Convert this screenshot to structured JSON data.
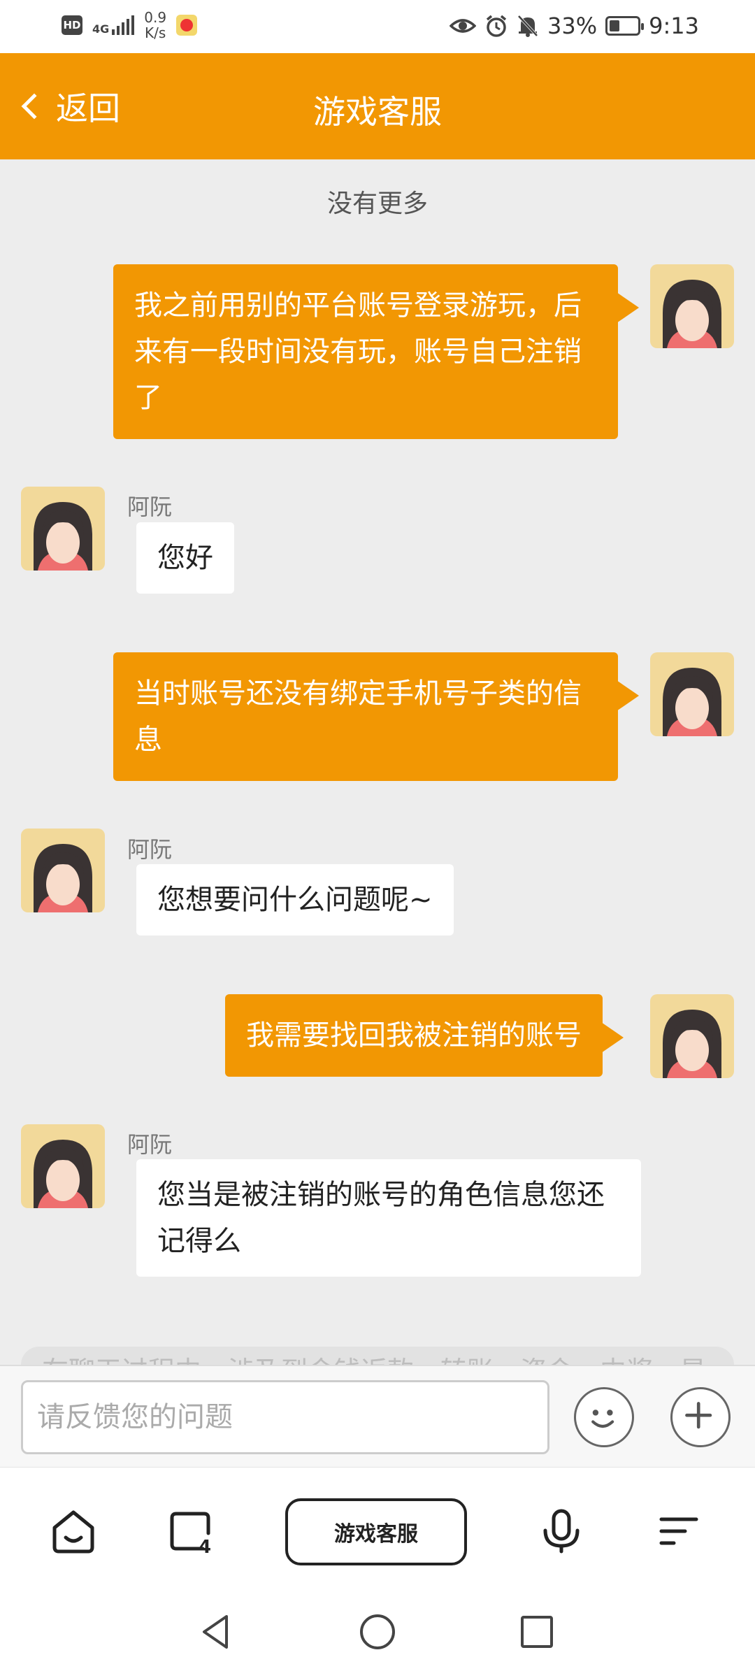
{
  "status_bar": {
    "hd": "HD",
    "network": "4G",
    "speed_value": "0.9",
    "speed_unit": "K/s",
    "battery": "33%",
    "time": "9:13"
  },
  "header": {
    "back_label": "返回",
    "title": "游戏客服"
  },
  "chat": {
    "no_more": "没有更多",
    "messages": [
      {
        "direction": "out",
        "text": "我之前用别的平台账号登录游玩，后来有一段时间没有玩，账号自己注销了"
      },
      {
        "direction": "in",
        "sender": "阿阮",
        "text": "您好"
      },
      {
        "direction": "out",
        "text": "当时账号还没有绑定手机号子类的信息"
      },
      {
        "direction": "in",
        "sender": "阿阮",
        "text": "您想要问什么问题呢~"
      },
      {
        "direction": "out",
        "text": "我需要找回我被注销的账号"
      },
      {
        "direction": "in",
        "sender": "阿阮",
        "text": "您当是被注销的账号的角色信息您还记得么"
      }
    ]
  },
  "notice": "在聊天过程中，涉及到金钱返款、转账、资金、中奖、星",
  "input": {
    "placeholder": "请反馈您的问题"
  },
  "nav": {
    "center_label": "游戏客服"
  },
  "colors": {
    "brand": "#f29703",
    "background": "#ededed"
  }
}
